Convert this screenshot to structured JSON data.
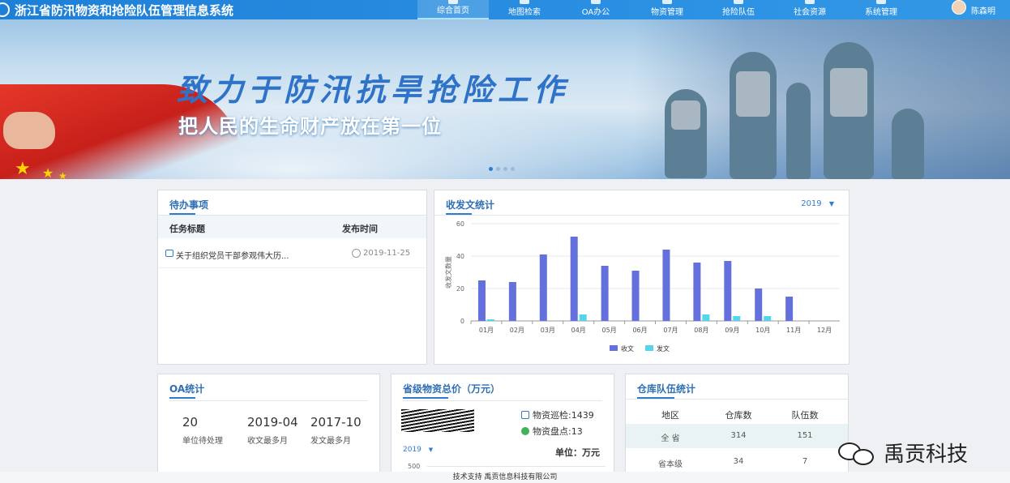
{
  "header": {
    "title": "浙江省防汛物资和抢险队伍管理信息系统",
    "nav": [
      "综合首页",
      "地图检索",
      "OA办公",
      "物资管理",
      "抢险队伍",
      "社会资源",
      "系统管理"
    ],
    "active_index": 0,
    "user_name": "陈森明"
  },
  "banner": {
    "slogan_main": "致力于防汛抗旱抢险工作",
    "slogan_sub": "把人民的生命财产放在第一位",
    "slides": 4,
    "current_slide": 0
  },
  "todo": {
    "title": "待办事项",
    "columns": [
      "任务标题",
      "发布时间"
    ],
    "rows": [
      {
        "title": "关于组织党员干部参观伟大历...",
        "date": "2019-11-25"
      }
    ]
  },
  "doc_stats": {
    "title": "收发文统计",
    "year": "2019",
    "year_arrow": "▼"
  },
  "chart_data": {
    "type": "bar",
    "title": "收发文统计",
    "ylabel": "收发文数量",
    "xlabel": "",
    "categories": [
      "01月",
      "02月",
      "03月",
      "04月",
      "05月",
      "06月",
      "07月",
      "08月",
      "09月",
      "10月",
      "11月",
      "12月"
    ],
    "series": [
      {
        "name": "收文",
        "color": "#6470dc",
        "values": [
          25,
          24,
          41,
          52,
          34,
          31,
          44,
          36,
          37,
          20,
          15,
          0
        ]
      },
      {
        "name": "发文",
        "color": "#55d5ea",
        "values": [
          1,
          0,
          0,
          4,
          0,
          0,
          0,
          4,
          3,
          3,
          0,
          0
        ]
      }
    ],
    "ylim": [
      0,
      60
    ],
    "yticks": [
      0,
      20,
      40,
      60
    ],
    "grid": true,
    "legend": "bottom-center"
  },
  "oa": {
    "title": "OA统计",
    "stats": [
      {
        "value": "20",
        "label": "单位待处理"
      },
      {
        "value": "2019-04",
        "label": "收文最多月"
      },
      {
        "value": "2017-10",
        "label": "发文最多月"
      }
    ]
  },
  "materials": {
    "title": "省级物资总价（万元）",
    "inspect_label": "物资巡检:",
    "inspect_value": "1439",
    "count_label": "物资盘点:",
    "count_value": "13",
    "year": "2019",
    "year_arrow": "▼",
    "unit": "单位：万元",
    "axis_top": "500"
  },
  "warehouse": {
    "title": "仓库队伍统计",
    "columns": [
      "地区",
      "仓库数",
      "队伍数"
    ],
    "rows": [
      {
        "region": "全 省",
        "warehouses": "314",
        "teams": "151"
      },
      {
        "region": "省本级",
        "warehouses": "34",
        "teams": "7"
      }
    ]
  },
  "footer": {
    "text": "技术支持 禹贡信息科技有限公司"
  },
  "watermark": {
    "text": "禹贡科技"
  }
}
